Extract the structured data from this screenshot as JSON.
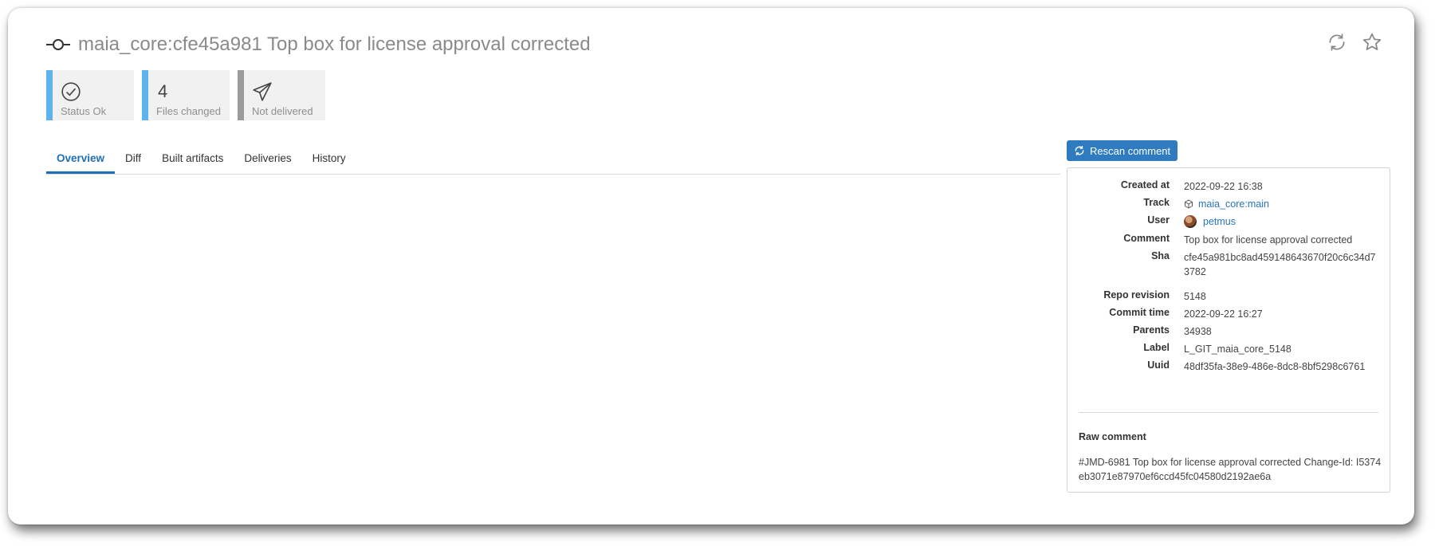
{
  "header": {
    "title": "maia_core:cfe45a981 Top box for license approval corrected",
    "actions": [
      "refresh-icon",
      "star-icon"
    ]
  },
  "stats": [
    {
      "icon": "check-circle-icon",
      "label": "Status Ok",
      "accent": "#5fb3ec"
    },
    {
      "value": "4",
      "label": "Files changed",
      "accent": "#5fb3ec"
    },
    {
      "icon": "paper-plane-icon",
      "label": "Not delivered",
      "accent": "#9b9b9b"
    }
  ],
  "tabs": [
    {
      "label": "Overview",
      "active": true
    },
    {
      "label": "Diff"
    },
    {
      "label": "Built artifacts"
    },
    {
      "label": "Deliveries"
    },
    {
      "label": "History"
    }
  ],
  "rescan_label": "Rescan comment",
  "details": {
    "created_at": {
      "label": "Created at",
      "value": "2022-09-22 16:38"
    },
    "track": {
      "label": "Track",
      "value": "maia_core:main"
    },
    "user": {
      "label": "User",
      "value": "petmus"
    },
    "comment": {
      "label": "Comment",
      "value": "Top box for license approval corrected"
    },
    "sha": {
      "label": "Sha",
      "value": "cfe45a981bc8ad459148643670f20c6c34d73782"
    },
    "repo_revision": {
      "label": "Repo revision",
      "value": "5148"
    },
    "commit_time": {
      "label": "Commit time",
      "value": "2022-09-22 16:27"
    },
    "parents": {
      "label": "Parents",
      "value": "34938"
    },
    "label": {
      "label": "Label",
      "value": "L_GIT_maia_core_5148"
    },
    "uuid": {
      "label": "Uuid",
      "value": "48df35fa-38e9-486e-8dc8-8bf5298c6761"
    }
  },
  "raw_comment": {
    "label": "Raw comment",
    "value": "#JMD-6981 Top box for license approval corrected Change-Id: I5374eb3071e87970ef6ccd45fc04580d2192ae6a"
  },
  "colors": {
    "accent": "#2f7bc0",
    "link": "#2a73ba",
    "tab_active": "#1d6fb8"
  }
}
